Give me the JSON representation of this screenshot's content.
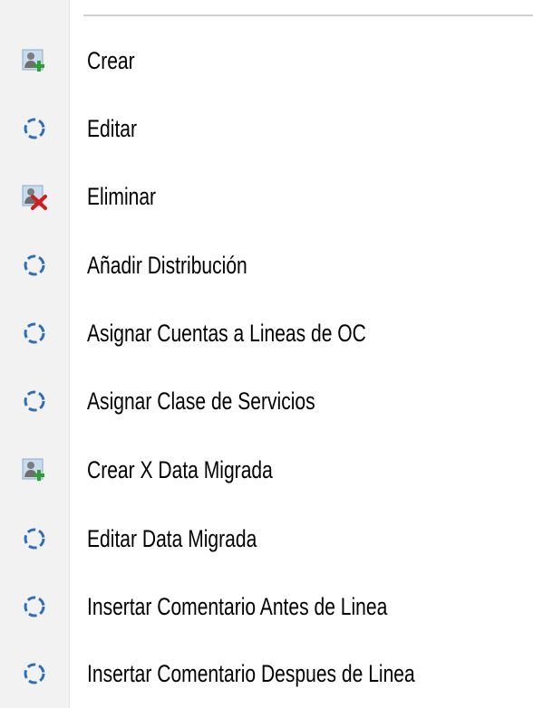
{
  "menu": {
    "items": [
      {
        "label": "Crear",
        "icon": "add-user-icon"
      },
      {
        "label": "Editar",
        "icon": "refresh-circle-icon"
      },
      {
        "label": "Eliminar",
        "icon": "delete-user-icon"
      },
      {
        "label": "Añadir Distribución",
        "icon": "refresh-circle-icon"
      },
      {
        "label": "Asignar Cuentas a Lineas de OC",
        "icon": "refresh-circle-icon"
      },
      {
        "label": "Asignar Clase de Servicios",
        "icon": "refresh-circle-icon"
      },
      {
        "label": "Crear X Data Migrada",
        "icon": "add-user-icon"
      },
      {
        "label": "Editar Data Migrada",
        "icon": "refresh-circle-icon"
      },
      {
        "label": "Insertar Comentario Antes de Linea",
        "icon": "refresh-circle-icon"
      },
      {
        "label": "Insertar Comentario Despues de Linea",
        "icon": "refresh-circle-icon"
      }
    ]
  },
  "colors": {
    "gutter": "#f2f2f2",
    "text": "#000000",
    "refresh_icon": "#2f6fb7",
    "add_icon_green": "#2e9e35",
    "delete_icon_red": "#d41a1a"
  }
}
